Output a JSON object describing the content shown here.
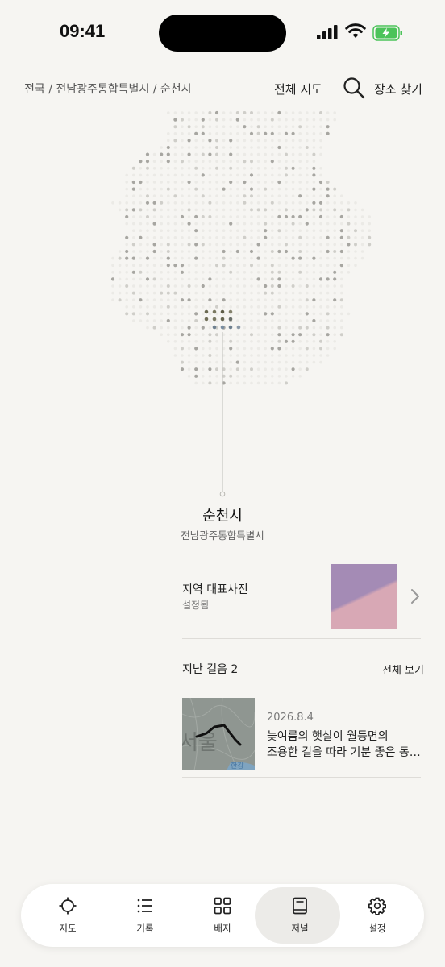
{
  "status_bar": {
    "time": "09:41"
  },
  "header": {
    "breadcrumb": "전국 / 전남광주통합특별시 / 순천시",
    "full_map_label": "전체 지도",
    "find_place_label": "장소 찾기",
    "search_icon": "search-icon"
  },
  "region": {
    "name": "순천시",
    "parent": "전남광주통합특별시"
  },
  "photo": {
    "title": "지역 대표사진",
    "status": "설정됨",
    "colors": [
      "#a48bb5",
      "#d8a8b5"
    ]
  },
  "walks": {
    "title": "지난 걸음 2",
    "see_all": "전체 보기",
    "items": [
      {
        "date": "2026.8.4",
        "line1": "늦여름의 햇살이 월등면의",
        "line2": "조용한 길을 따라 기분 좋은 동…",
        "map_label": "서울",
        "river_label": "한강"
      }
    ]
  },
  "tabs": [
    {
      "label": "지도",
      "icon": "crosshair-icon"
    },
    {
      "label": "기록",
      "icon": "list-icon"
    },
    {
      "label": "배지",
      "icon": "grid-icon"
    },
    {
      "label": "저널",
      "icon": "book-icon"
    },
    {
      "label": "설정",
      "icon": "gear-icon"
    }
  ],
  "active_tab": "저널"
}
